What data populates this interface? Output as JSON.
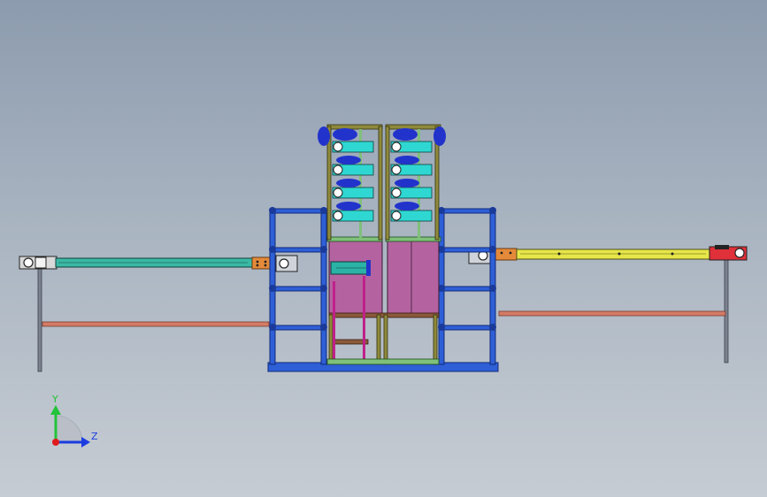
{
  "viewport": {
    "background_top": "#8c9bae",
    "background_bottom": "#c6ccd3"
  },
  "triad": {
    "y_label": "Y",
    "z_label": "Z",
    "y_color": "#22c33a",
    "z_color": "#1b3de0",
    "origin_color": "#e01b1b"
  },
  "colors": {
    "frame_blue": "#2e5fd6",
    "frame_dark": "#1a3a9a",
    "tower_olive": "#8f8a3c",
    "tower_green": "#7fc07a",
    "cyan_block": "#2fd7d2",
    "deep_blue": "#2233cc",
    "magenta_panel": "#b463a0",
    "pink_rod": "#c0208a",
    "brown_beam": "#8a5a3a",
    "teal_cylinder": "#2bb2a6",
    "left_conveyor": "#3ab9a5",
    "right_conveyor": "#e6e64a",
    "red_motor": "#e0303a",
    "salmon_rail": "#d47b66",
    "orange_plate": "#e48a3a",
    "gray_leg": "#8a8f9a"
  }
}
